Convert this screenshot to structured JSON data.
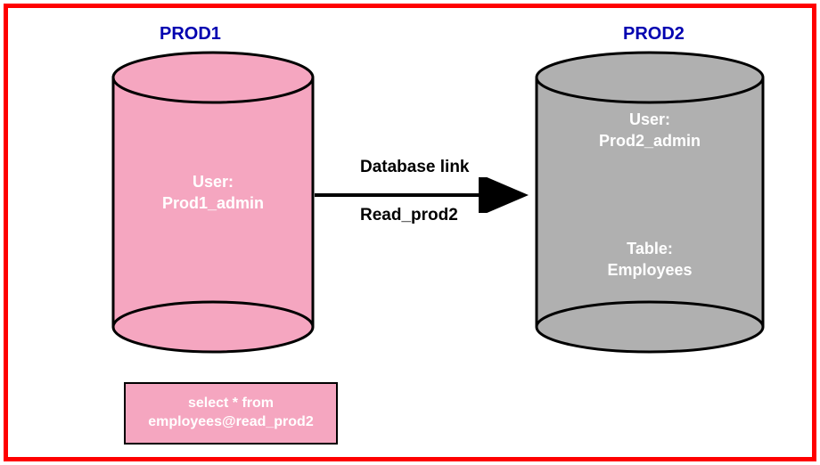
{
  "db_left": {
    "title": "PROD1",
    "user_label": "User:",
    "user_value": "Prod1_admin"
  },
  "db_right": {
    "title": "PROD2",
    "user_label": "User:",
    "user_value": "Prod2_admin",
    "table_label": "Table:",
    "table_value": "Employees"
  },
  "link": {
    "label_top": "Database link",
    "label_bottom": "Read_prod2"
  },
  "sql": {
    "line1": "select * from",
    "line2": "employees@read_prod2"
  },
  "colors": {
    "frame": "#ff0000",
    "title": "#0000b0",
    "pink": "#f5a6c0",
    "gray": "#b0b0b0"
  }
}
